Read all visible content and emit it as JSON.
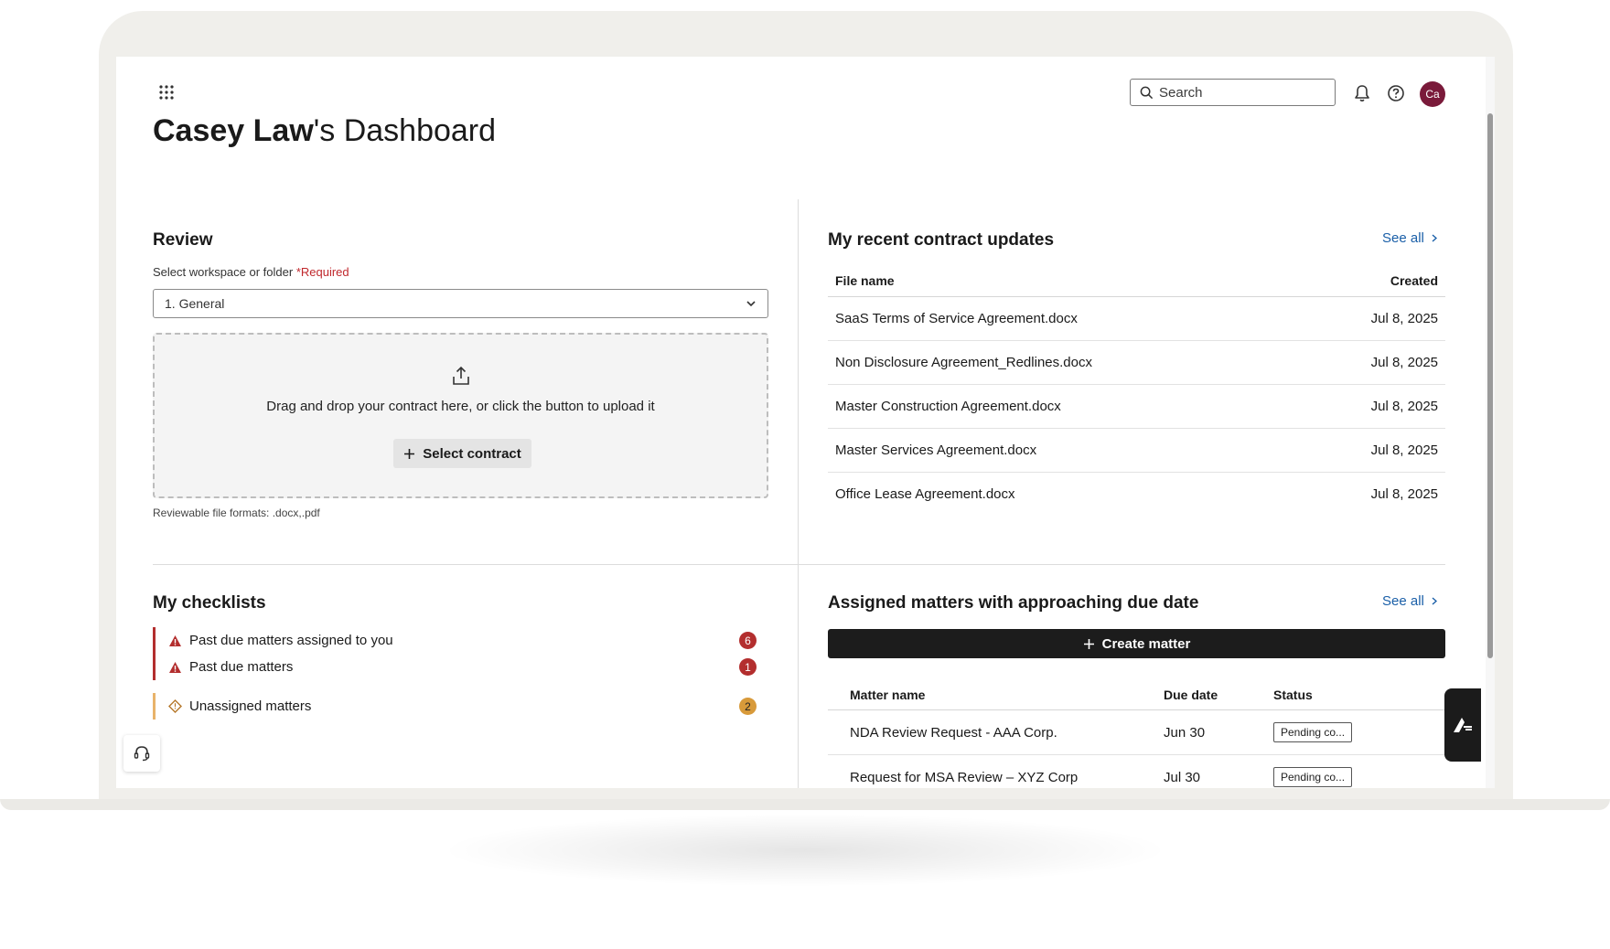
{
  "header": {
    "title_bold": "Casey Law",
    "title_rest": "'s Dashboard",
    "search_placeholder": "Search",
    "avatar_initials": "Ca"
  },
  "review": {
    "title": "Review",
    "workspace_label": "Select workspace or folder",
    "required_label": "*Required",
    "workspace_value": "1. General",
    "drop_text": "Drag and drop your contract here, or click the button to upload it",
    "select_button": "Select contract",
    "formats": "Reviewable file formats: .docx,.pdf"
  },
  "contracts": {
    "title": "My recent contract updates",
    "see_all": "See all",
    "columns": [
      "File name",
      "Created"
    ],
    "rows": [
      {
        "name": "SaaS Terms of Service Agreement.docx",
        "created": "Jul 8, 2025"
      },
      {
        "name": "Non Disclosure Agreement_Redlines.docx",
        "created": "Jul 8, 2025"
      },
      {
        "name": "Master Construction Agreement.docx",
        "created": "Jul 8, 2025"
      },
      {
        "name": "Master Services Agreement.docx",
        "created": "Jul 8, 2025"
      },
      {
        "name": "Office Lease Agreement.docx",
        "created": "Jul 8, 2025"
      }
    ]
  },
  "checklists": {
    "title": "My checklists",
    "items": [
      {
        "label": "Past due matters assigned to you",
        "count": "6"
      },
      {
        "label": "Past due matters",
        "count": "1"
      },
      {
        "label": "Unassigned matters",
        "count": "2"
      }
    ]
  },
  "matters": {
    "title": "Assigned matters with approaching due date",
    "see_all": "See all",
    "create_button": "Create matter",
    "columns": [
      "Matter name",
      "Due date",
      "Status"
    ],
    "rows": [
      {
        "name": "NDA Review Request - AAA Corp.",
        "due": "Jun 30",
        "status": "Pending co..."
      },
      {
        "name": "Request for MSA Review – XYZ Corp",
        "due": "Jul 30",
        "status": "Pending co..."
      }
    ]
  },
  "colors": {
    "accent_link": "#1a5fa8",
    "required": "#c0282d",
    "danger": "#b32e2e",
    "warning": "#d89a3a",
    "avatar": "#7a1a3a"
  }
}
